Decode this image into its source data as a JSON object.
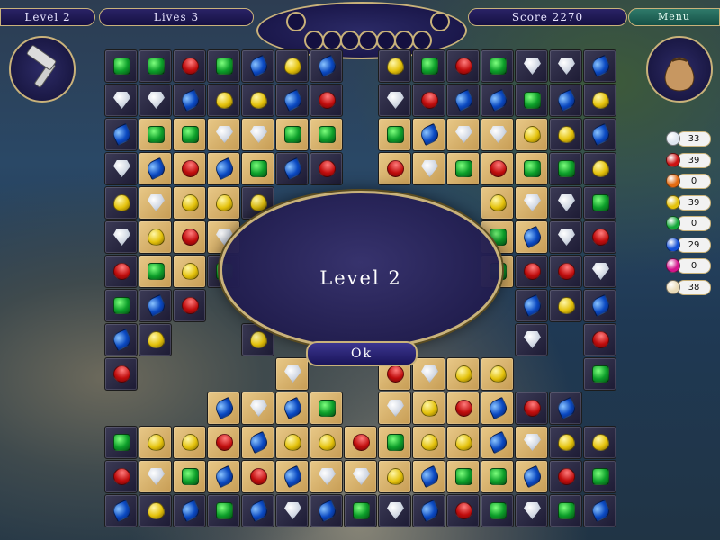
{
  "hud": {
    "level_label": "Level 2",
    "lives_label": "Lives 3",
    "score_label": "Score 2270",
    "menu_label": "Menu",
    "medallion_slots": 9
  },
  "tools": {
    "left_tool_icon": "hammer-icon",
    "right_tool_icon": "pouch-icon"
  },
  "colors": {
    "panel_dark": "#1d1b34",
    "tile_light": "#e8c887",
    "gold_trim": "#c9b27a",
    "dialog_bg": "#18144d"
  },
  "board": {
    "rows": [
      "GGRGBYB.YGRGWWB",
      "WWBYYBR.WRBBGBY",
      "BgGWWGG.GBWWYYB",
      "WBRBGBR.RWGRGGY",
      "YWYYY......YWWG",
      "WYRW.......GBWR",
      "RGYG.......GRRW",
      "GBR.........BYB",
      "BY..Y.......W.R",
      "R....W..RWYY..G",
      "...BWBG.WYRBRB.",
      "GYYRBYYRGYYBWYY",
      "RWGBRBWWYBGGBRG",
      "BYBGBWBGWBRGWGB"
    ],
    "light_cells": [
      [
        2,
        1
      ],
      [
        2,
        2
      ],
      [
        2,
        3
      ],
      [
        2,
        4
      ],
      [
        2,
        5
      ],
      [
        2,
        6
      ],
      [
        2,
        8
      ],
      [
        2,
        9
      ],
      [
        2,
        10
      ],
      [
        2,
        11
      ],
      [
        2,
        12
      ],
      [
        3,
        1
      ],
      [
        3,
        2
      ],
      [
        3,
        3
      ],
      [
        3,
        4
      ],
      [
        3,
        8
      ],
      [
        3,
        9
      ],
      [
        3,
        10
      ],
      [
        3,
        11
      ],
      [
        3,
        12
      ],
      [
        4,
        1
      ],
      [
        4,
        2
      ],
      [
        4,
        3
      ],
      [
        4,
        11
      ],
      [
        4,
        12
      ],
      [
        5,
        1
      ],
      [
        5,
        2
      ],
      [
        5,
        3
      ],
      [
        5,
        11
      ],
      [
        5,
        12
      ],
      [
        6,
        1
      ],
      [
        6,
        2
      ],
      [
        6,
        11
      ],
      [
        9,
        3
      ],
      [
        9,
        4
      ],
      [
        9,
        5
      ],
      [
        9,
        6
      ],
      [
        9,
        7
      ],
      [
        9,
        8
      ],
      [
        9,
        9
      ],
      [
        9,
        10
      ],
      [
        9,
        11
      ],
      [
        10,
        2
      ],
      [
        10,
        3
      ],
      [
        10,
        4
      ],
      [
        10,
        5
      ],
      [
        10,
        6
      ],
      [
        10,
        7
      ],
      [
        10,
        8
      ],
      [
        10,
        9
      ],
      [
        10,
        10
      ],
      [
        10,
        11
      ],
      [
        11,
        1
      ],
      [
        11,
        2
      ],
      [
        11,
        3
      ],
      [
        11,
        4
      ],
      [
        11,
        5
      ],
      [
        11,
        6
      ],
      [
        11,
        7
      ],
      [
        11,
        8
      ],
      [
        11,
        9
      ],
      [
        11,
        10
      ],
      [
        11,
        11
      ],
      [
        11,
        12
      ],
      [
        12,
        1
      ],
      [
        12,
        2
      ],
      [
        12,
        3
      ],
      [
        12,
        4
      ],
      [
        12,
        5
      ],
      [
        12,
        6
      ],
      [
        12,
        7
      ],
      [
        12,
        8
      ],
      [
        12,
        9
      ],
      [
        12,
        10
      ],
      [
        12,
        11
      ],
      [
        12,
        12
      ]
    ]
  },
  "dialog": {
    "title": "Level 2",
    "ok_label": "Ok"
  },
  "gem_counts": [
    {
      "gem": "diamond",
      "color": "#dfe6ef",
      "count": "33"
    },
    {
      "gem": "ruby",
      "color": "#cc1212",
      "count": "39"
    },
    {
      "gem": "amber",
      "color": "#e36a10",
      "count": "0"
    },
    {
      "gem": "topaz",
      "color": "#e4c20c",
      "count": "39"
    },
    {
      "gem": "emerald",
      "color": "#14a83a",
      "count": "0"
    },
    {
      "gem": "sapphire",
      "color": "#1450d6",
      "count": "29"
    },
    {
      "gem": "pink",
      "color": "#d4148c",
      "count": "0"
    },
    {
      "gem": "pearl",
      "color": "#eadbb8",
      "count": "38"
    }
  ]
}
